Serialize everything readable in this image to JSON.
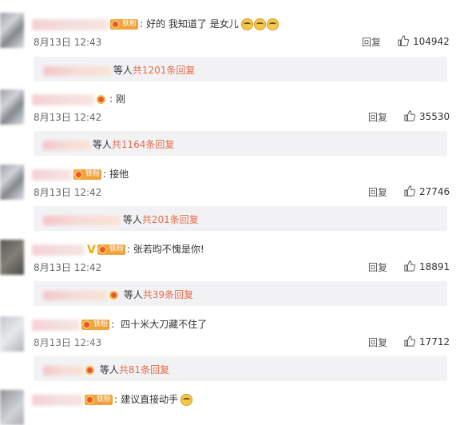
{
  "comments": [
    {
      "text": "好的 我知道了 是女儿",
      "badge": "铁粉",
      "time": "8月13日 12:43",
      "reply_label": "回复",
      "likes": "104942",
      "sub": {
        "suffix": "等人",
        "count": "共1201条回复"
      },
      "emoji_count": 3
    },
    {
      "text": "刚",
      "badge": "",
      "time": "8月13日 12:42",
      "reply_label": "回复",
      "likes": "35530",
      "sub": {
        "suffix": "等人",
        "count": "共1164条回复"
      }
    },
    {
      "text": "接他",
      "badge": "铁粉",
      "time": "8月13日 12:42",
      "reply_label": "回复",
      "likes": "27746",
      "sub": {
        "suffix": "等人",
        "count": "共201条回复"
      }
    },
    {
      "text": "张若昀不愧是你!",
      "badge": "铁粉",
      "time": "8月13日 12:42",
      "reply_label": "回复",
      "likes": "18891",
      "sub": {
        "suffix": "等人",
        "count": "共39条回复"
      }
    },
    {
      "text": "四十米大刀藏不住了",
      "badge": "铁粉",
      "time": "8月13日 12:43",
      "reply_label": "回复",
      "likes": "17712",
      "sub": {
        "suffix": "等人",
        "count": "共81条回复"
      }
    },
    {
      "text": "建议直接动手",
      "badge": "铁粉",
      "time": "",
      "reply_label": "",
      "likes": ""
    }
  ],
  "colors": {
    "count": "#e86a48",
    "badge": "#f0a33c",
    "sub_bg": "#f2f2f5"
  },
  "icons": {
    "like": "thumbs-up-icon",
    "badge": "fan-badge-icon",
    "verified": "verified-v-icon"
  }
}
